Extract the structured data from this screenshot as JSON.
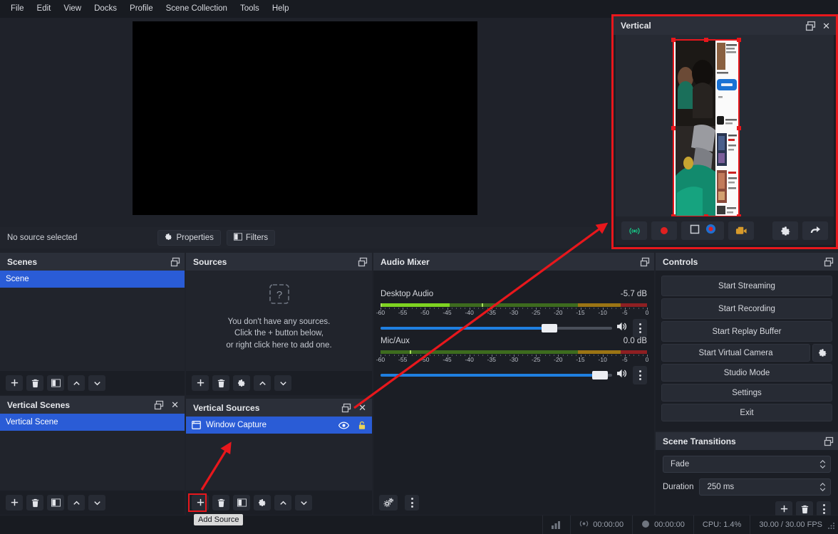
{
  "menubar": {
    "items": [
      "File",
      "Edit",
      "View",
      "Docks",
      "Profile",
      "Scene Collection",
      "Tools",
      "Help"
    ]
  },
  "source_bar": {
    "status": "No source selected",
    "properties_label": "Properties",
    "filters_label": "Filters"
  },
  "scenes": {
    "title": "Scenes",
    "items": [
      {
        "label": "Scene",
        "selected": true
      }
    ]
  },
  "sources": {
    "title": "Sources",
    "empty_icon": "question-placeholder-icon",
    "empty_line1": "You don't have any sources.",
    "empty_line2": "Click the + button below,",
    "empty_line3": "or right click here to add one."
  },
  "vertical_scenes": {
    "title": "Vertical Scenes",
    "items": [
      {
        "label": "Vertical Scene",
        "selected": true
      }
    ]
  },
  "vertical_sources": {
    "title": "Vertical Sources",
    "items": [
      {
        "label": "Window Capture",
        "selected": true,
        "icon": "window-capture-icon",
        "eye": "eye-icon",
        "lock": "lock-icon"
      }
    ],
    "tooltip": "Add Source"
  },
  "audio_mixer": {
    "title": "Audio Mixer",
    "tracks": [
      {
        "name": "Desktop Audio",
        "db": "-5.7 dB",
        "volume_percent": 73,
        "meter_level_percent": 26,
        "peak_percent": 38
      },
      {
        "name": "Mic/Aux",
        "db": "0.0 dB",
        "volume_percent": 97,
        "meter_level_percent": 0,
        "peak_percent": 11
      }
    ],
    "tick_labels": [
      "-60",
      "-55",
      "-50",
      "-45",
      "-40",
      "-35",
      "-30",
      "-25",
      "-20",
      "-15",
      "-10",
      "-5",
      "0"
    ],
    "advanced_properties_icon": "gears-icon",
    "menu_icon": "kebab-icon"
  },
  "controls": {
    "title": "Controls",
    "buttons": [
      "Start Streaming",
      "Start Recording",
      "Start Replay Buffer",
      "Start Virtual Camera",
      "Studio Mode",
      "Settings",
      "Exit"
    ],
    "vcam_config_icon": "gear-icon"
  },
  "scene_transitions": {
    "title": "Scene Transitions",
    "transition": "Fade",
    "duration_label": "Duration",
    "duration_value": "250 ms"
  },
  "vertical_dock": {
    "title": "Vertical",
    "toolbar_buttons": [
      "vertical-stream-icon",
      "vertical-record-icon",
      "vertical-stop-icon",
      "vertical-replay-icon",
      "vertical-virtualcam-icon",
      "vertical-settings-icon",
      "vertical-fullscreen-icon"
    ]
  },
  "statusbar": {
    "stream_time": "00:00:00",
    "record_time": "00:00:00",
    "cpu": "CPU: 1.4%",
    "fps": "30.00 / 30.00 FPS"
  },
  "colors": {
    "accent_blue": "#2a5cd6",
    "annotation_red": "#e8171c",
    "slider_blue": "#1f7fe0",
    "panel_bg": "#1b1e25",
    "list_bg": "#21242c"
  }
}
